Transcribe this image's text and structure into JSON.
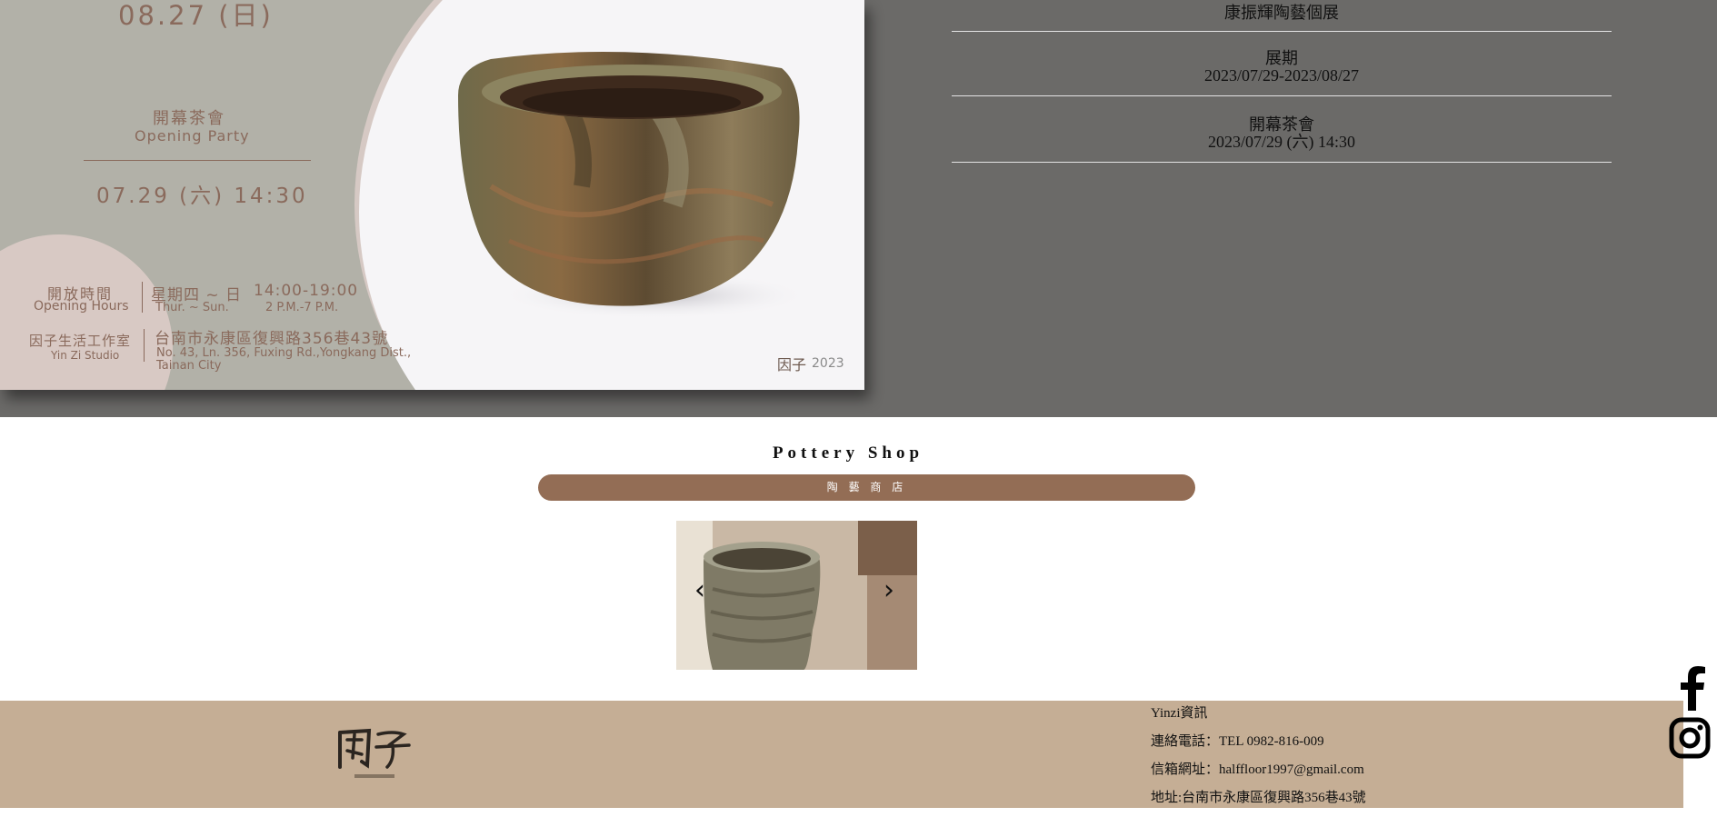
{
  "poster": {
    "end_date": "08.27 (日)",
    "opening_party_zh": "開幕茶會",
    "opening_party_en": "Opening Party",
    "party_date": "07.29 (六) 14:30",
    "opening_hours_zh": "開放時間",
    "opening_hours_en": "Opening Hours",
    "days_zh": "星期四 ~ 日",
    "days_en": "Thur. ~ Sun.",
    "time_zh": "14:00-19:00",
    "time_en": "2 P.M.-7 P.M.",
    "studio_zh": "因子生活工作室",
    "studio_en": "Yin Zi Studio",
    "address_zh": "台南市永康區復興路356巷43號",
    "address_en_line1": "No. 43, Ln. 356, Fuxing Rd.,Yongkang Dist.,",
    "address_en_line2": "Tainan City",
    "year": "2023"
  },
  "exhibition_info": {
    "title": "康振輝陶藝個展",
    "period_label": "展期",
    "period_value": "2023/07/29-2023/08/27",
    "party_label": "開幕茶會",
    "party_value": "2023/07/29 (六) 14:30"
  },
  "shop": {
    "title": "Pottery Shop",
    "button_label": "陶 藝 商 店",
    "prev_arrow": "‹",
    "next_arrow": "›"
  },
  "footer": {
    "heading": "Yinzi資訊",
    "phone": "連絡電話：TEL 0982-816-009",
    "email": "信箱網址：halffloor1997@gmail.com",
    "address": "地址:台南市永康區復興路356巷43號"
  },
  "social": {
    "icons": [
      "facebook-icon",
      "instagram-icon"
    ]
  },
  "colors": {
    "top_band": "#6b6a68",
    "poster_bg": "#b2b1a8",
    "poster_text": "#8a6a5c",
    "shop_button": "#936d55",
    "footer_bg": "#c5ae95"
  }
}
